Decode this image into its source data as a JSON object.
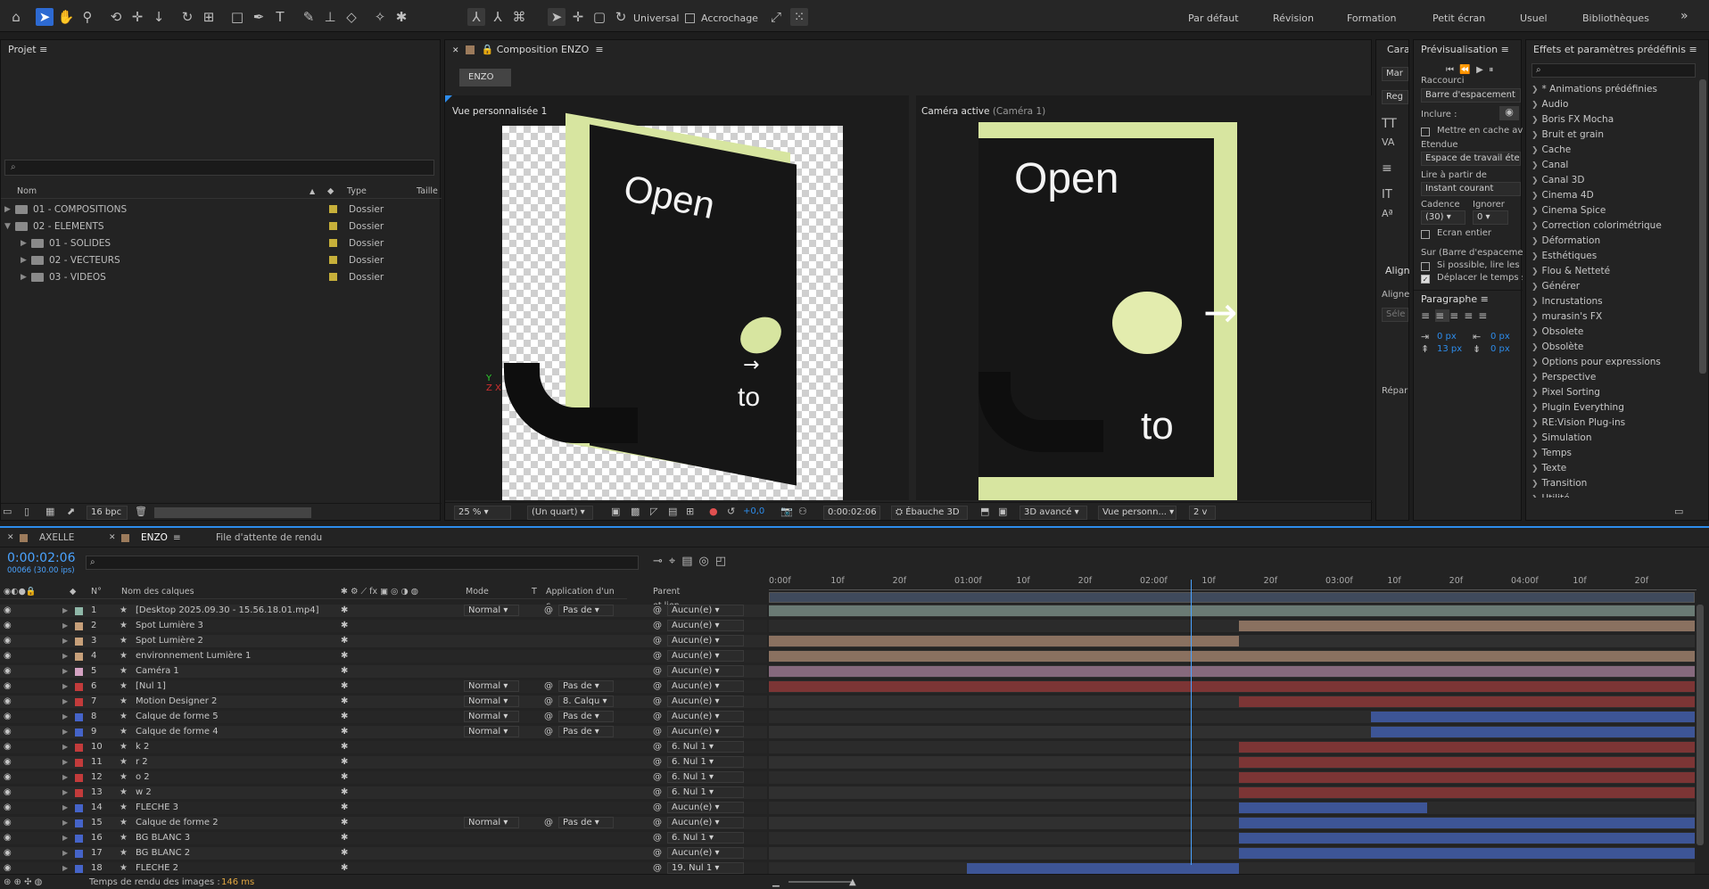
{
  "toolbar": {
    "universal_label": "Universal",
    "snapping_label": "Accrochage",
    "workspaces": [
      "Par défaut",
      "Révision",
      "Formation",
      "Petit écran",
      "Usuel",
      "Bibliothèques"
    ],
    "more": "»"
  },
  "project": {
    "title": "Projet",
    "search_placeholder": "",
    "columns": {
      "name": "Nom",
      "type": "Type",
      "size": "Taille"
    },
    "items": [
      {
        "name": "01 - COMPOSITIONS",
        "type": "Dossier",
        "indent": 0,
        "expanded": false
      },
      {
        "name": "02 - ELEMENTS",
        "type": "Dossier",
        "indent": 0,
        "expanded": true
      },
      {
        "name": "01 - SOLIDES",
        "type": "Dossier",
        "indent": 1,
        "expanded": false
      },
      {
        "name": "02 - VECTEURS",
        "type": "Dossier",
        "indent": 1,
        "expanded": false
      },
      {
        "name": "03 - VIDEOS",
        "type": "Dossier",
        "indent": 1,
        "expanded": false
      }
    ],
    "bpc": "16 bpc"
  },
  "composition": {
    "title": "Composition ENZO",
    "tab": "ENZO",
    "view_left_label": "Vue personnalisée 1",
    "view_right_label": "Caméra active",
    "view_right_sub": "(Caméra 1)",
    "canvas_open": "Open",
    "canvas_to": "to",
    "zoom": "25 %",
    "resolution": "(Un quart)",
    "exposure": "+0,0",
    "timecode": "0:00:02:06",
    "renderer_draft": "Ébauche 3D",
    "renderer": "3D avancé",
    "view_select": "Vue personn...",
    "views_count": "2 v"
  },
  "character_panel": {
    "title": "Cara",
    "items": [
      "Mar",
      "Reg"
    ]
  },
  "align_panel": {
    "title": "Align",
    "align_label": "Aligne",
    "select": "Séle",
    "distribute": "Répar"
  },
  "preview": {
    "title": "Prévisualisation",
    "shortcut_label": "Raccourci",
    "shortcut_value": "Barre d'espacement",
    "include_label": "Inclure :",
    "cache_label": "Mettre en cache ava",
    "extent_label": "Etendue",
    "extent_value": "Espace de travail étend",
    "play_from_label": "Lire à partir de",
    "play_from_value": "Instant courant",
    "fps_label": "Cadence",
    "skip_label": "Ignorer",
    "fps_value": "(30)",
    "skip_value": "0",
    "fullscreen_label": "Ecran entier",
    "on_label": "Sur (Barre d'espacement",
    "if_possible_label": "Si possible, lire les in",
    "move_time_label": "Déplacer le temps su"
  },
  "paragraph": {
    "title": "Paragraphe",
    "indent_left": "0 px",
    "indent_right": "0 px",
    "space_before": "13 px",
    "space_after": "0 px"
  },
  "effects": {
    "title": "Effets et paramètres prédéfinis",
    "search_placeholder": "",
    "items": [
      "* Animations prédéfinies",
      "Audio",
      "Boris FX Mocha",
      "Bruit et grain",
      "Cache",
      "Canal",
      "Canal 3D",
      "Cinema 4D",
      "Cinema Spice",
      "Correction colorimétrique",
      "Déformation",
      "Esthétiques",
      "Flou & Netteté",
      "Générer",
      "Incrustations",
      "murasin's FX",
      "Obsolete",
      "Obsolète",
      "Options pour expressions",
      "Perspective",
      "Pixel Sorting",
      "Plugin Everything",
      "RE:Vision Plug-ins",
      "Simulation",
      "Temps",
      "Texte",
      "Transition",
      "Utilité"
    ]
  },
  "timeline": {
    "tabs": [
      "AXELLE",
      "ENZO",
      "File d'attente de rendu"
    ],
    "timecode": "0:00:02:06",
    "frame_info": "00066 (30.00 ips)",
    "search_placeholder": "",
    "columns": {
      "num": "N°",
      "name": "Nom des calques",
      "mode": "Mode",
      "t": "T",
      "matte": "Application d'un c...",
      "parent": "Parent et lien"
    },
    "ruler": [
      "0:00f",
      "10f",
      "20f",
      "01:00f",
      "10f",
      "20f",
      "02:00f",
      "10f",
      "20f",
      "03:00f",
      "10f",
      "20f",
      "04:00f",
      "10f",
      "20f"
    ],
    "render_time_label": "Temps de rendu des images :",
    "render_time_value": "146 ms",
    "playhead": 0.456,
    "layers": [
      {
        "num": "1",
        "name": "[Desktop 2025.09.30 - 15.56.18.01.mp4]",
        "color": "#8fb7a8",
        "mode": "Normal",
        "matte": "Pas de",
        "parent": "Aucun(e)",
        "bar_color": "#6a7a74",
        "start": 0.0,
        "end": 1.0
      },
      {
        "num": "2",
        "name": "Spot Lumière 3",
        "color": "#c7a07a",
        "mode": "",
        "matte": "",
        "parent": "Aucun(e)",
        "bar_color": "#8a7160",
        "start": 0.508,
        "end": 1.0
      },
      {
        "num": "3",
        "name": "Spot Lumière 2",
        "color": "#c7a07a",
        "mode": "",
        "matte": "",
        "parent": "Aucun(e)",
        "bar_color": "#8a7160",
        "start": 0.0,
        "end": 0.508
      },
      {
        "num": "4",
        "name": "environnement Lumière 1",
        "color": "#c7a07a",
        "mode": "",
        "matte": "",
        "parent": "Aucun(e)",
        "bar_color": "#8a7160",
        "start": 0.0,
        "end": 1.0
      },
      {
        "num": "5",
        "name": "Caméra 1",
        "color": "#d3a2c2",
        "mode": "",
        "matte": "",
        "parent": "Aucun(e)",
        "bar_color": "#86697d",
        "start": 0.0,
        "end": 1.0
      },
      {
        "num": "6",
        "name": "[Nul 1]",
        "color": "#c23b3b",
        "mode": "Normal",
        "matte": "Pas de",
        "parent": "Aucun(e)",
        "bar_color": "#7c3535",
        "start": 0.0,
        "end": 1.0
      },
      {
        "num": "7",
        "name": "Motion Designer 2",
        "color": "#c23b3b",
        "mode": "Normal",
        "matte": "8. Calqu",
        "parent": "Aucun(e)",
        "bar_color": "#7c3535",
        "start": 0.508,
        "end": 1.0
      },
      {
        "num": "8",
        "name": "Calque de forme 5",
        "color": "#4564c9",
        "mode": "Normal",
        "matte": "Pas de",
        "parent": "Aucun(e)",
        "bar_color": "#3d5596",
        "start": 0.65,
        "end": 1.0
      },
      {
        "num": "9",
        "name": "Calque de forme 4",
        "color": "#4564c9",
        "mode": "Normal",
        "matte": "Pas de",
        "parent": "Aucun(e)",
        "bar_color": "#3d5596",
        "start": 0.65,
        "end": 1.0
      },
      {
        "num": "10",
        "name": "k 2",
        "color": "#c23b3b",
        "mode": "",
        "matte": "",
        "parent": "6. Nul 1",
        "bar_color": "#7c3535",
        "start": 0.508,
        "end": 1.0
      },
      {
        "num": "11",
        "name": "r 2",
        "color": "#c23b3b",
        "mode": "",
        "matte": "",
        "parent": "6. Nul 1",
        "bar_color": "#7c3535",
        "start": 0.508,
        "end": 1.0
      },
      {
        "num": "12",
        "name": "o 2",
        "color": "#c23b3b",
        "mode": "",
        "matte": "",
        "parent": "6. Nul 1",
        "bar_color": "#7c3535",
        "start": 0.508,
        "end": 1.0
      },
      {
        "num": "13",
        "name": "w 2",
        "color": "#c23b3b",
        "mode": "",
        "matte": "",
        "parent": "6. Nul 1",
        "bar_color": "#7c3535",
        "start": 0.508,
        "end": 1.0
      },
      {
        "num": "14",
        "name": "FLECHE 3",
        "color": "#4564c9",
        "mode": "",
        "matte": "",
        "parent": "Aucun(e)",
        "bar_color": "#3d5596",
        "start": 0.508,
        "end": 0.711
      },
      {
        "num": "15",
        "name": "Calque de forme 2",
        "color": "#4564c9",
        "mode": "Normal",
        "matte": "Pas de",
        "parent": "Aucun(e)",
        "bar_color": "#3d5596",
        "start": 0.508,
        "end": 1.0
      },
      {
        "num": "16",
        "name": "BG BLANC 3",
        "color": "#4564c9",
        "mode": "",
        "matte": "",
        "parent": "6. Nul 1",
        "bar_color": "#3d5596",
        "start": 0.508,
        "end": 1.0
      },
      {
        "num": "17",
        "name": "BG BLANC 2",
        "color": "#4564c9",
        "mode": "",
        "matte": "",
        "parent": "Aucun(e)",
        "bar_color": "#3d5596",
        "start": 0.508,
        "end": 1.0
      },
      {
        "num": "18",
        "name": "FLECHE 2",
        "color": "#4564c9",
        "mode": "",
        "matte": "",
        "parent": "19. Nul 1",
        "bar_color": "#3d5596",
        "start": 0.214,
        "end": 0.508
      }
    ]
  },
  "colors": {
    "accent": "#2d8ceb",
    "panel": "#232323",
    "canvas_green": "#d7e5a0"
  }
}
